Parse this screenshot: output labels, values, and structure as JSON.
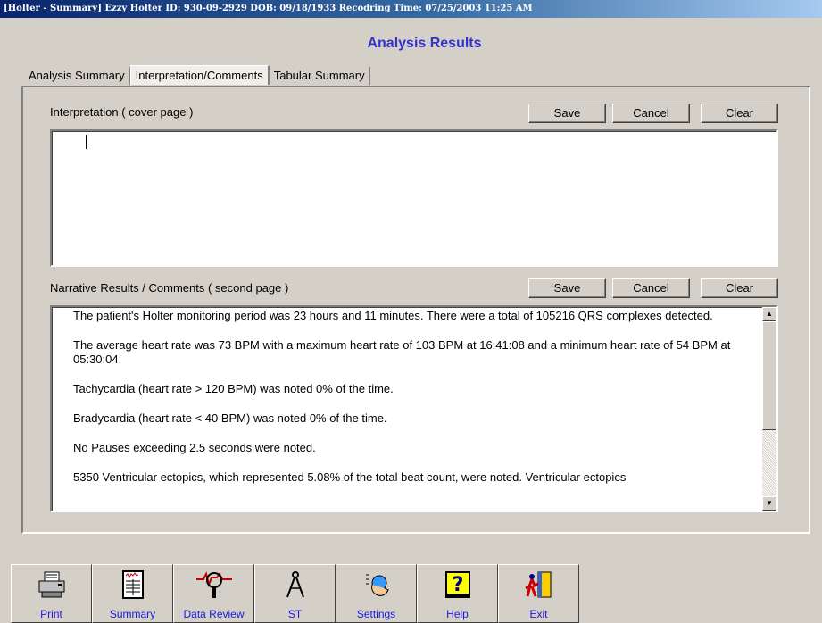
{
  "window": {
    "title": "[Holter - Summary]  Ezzy Holter  ID: 930-09-2929  DOB: 09/18/1933  Recodring Time: 07/25/2003 11:25 AM"
  },
  "page": {
    "heading": "Analysis Results"
  },
  "tabs": [
    {
      "label": "Analysis Summary"
    },
    {
      "label": "Interpretation/Comments",
      "active": true
    },
    {
      "label": "Tabular Summary"
    }
  ],
  "interpretation": {
    "label": "Interpretation ( cover page )",
    "save": "Save",
    "cancel": "Cancel",
    "clear": "Clear",
    "value": ""
  },
  "narrative": {
    "label": "Narrative Results / Comments ( second page )",
    "save": "Save",
    "cancel": "Cancel",
    "clear": "Clear",
    "paragraphs": [
      "The patient's Holter monitoring period was 23 hours and 11 minutes. There were a total of 105216 QRS complexes detected.",
      "The average heart rate was 73 BPM with a maximum heart rate of 103 BPM at 16:41:08 and a minimum heart rate of 54 BPM at 05:30:04.",
      "Tachycardia (heart rate > 120 BPM) was noted 0% of the time.",
      "Bradycardia (heart rate < 40 BPM) was noted 0% of the time.",
      "No Pauses exceeding 2.5 seconds were noted.",
      "5350 Ventricular ectopics, which represented 5.08% of the total beat count, were noted. Ventricular ectopics"
    ]
  },
  "toolbar": {
    "buttons": [
      {
        "label": "Print",
        "icon": "printer-icon"
      },
      {
        "label": "Summary",
        "icon": "summary-report-icon"
      },
      {
        "label": "Data Review",
        "icon": "magnifier-ecg-icon"
      },
      {
        "label": "ST",
        "icon": "compass-icon"
      },
      {
        "label": "Settings",
        "icon": "settings-hand-icon"
      },
      {
        "label": "Help",
        "icon": "help-question-icon"
      },
      {
        "label": "Exit",
        "icon": "exit-door-icon"
      }
    ]
  },
  "colors": {
    "title_bar": "#08246B",
    "heading": "#3333CC",
    "toolbar_label": "#1A1AE0",
    "background": "#D4D0C8"
  }
}
